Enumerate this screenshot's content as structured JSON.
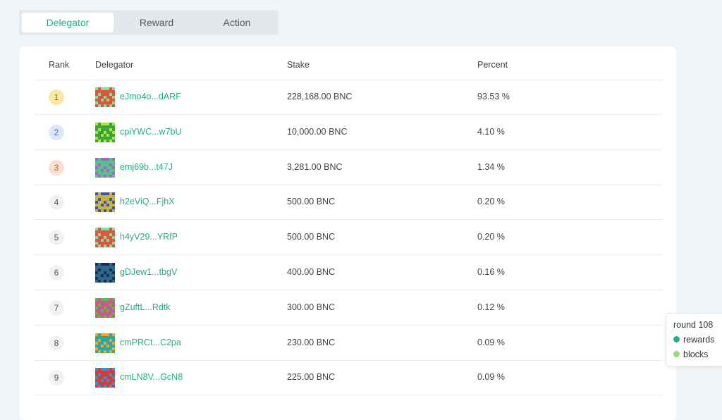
{
  "tabs": [
    {
      "label": "Delegator",
      "active": true
    },
    {
      "label": "Reward",
      "active": false
    },
    {
      "label": "Action",
      "active": false
    }
  ],
  "table": {
    "headers": {
      "rank": "Rank",
      "delegator": "Delegator",
      "stake": "Stake",
      "percent": "Percent"
    },
    "rows": [
      {
        "rank": "1",
        "address": "eJmo4o...dARF",
        "stake": "228,168.00 BNC",
        "percent": "93.53 %",
        "rank_bg": "#fde7a4",
        "rank_color": "#8a6a10",
        "avatar": {
          "bg": "#7ce0a0",
          "fg": "#e0553a"
        }
      },
      {
        "rank": "2",
        "address": "cpiYWC...w7bU",
        "stake": "10,000.00 BNC",
        "percent": "4.10 %",
        "rank_bg": "#dbe6fb",
        "rank_color": "#4a6aa8",
        "avatar": {
          "bg": "#b6e03b",
          "fg": "#3aa53a"
        }
      },
      {
        "rank": "3",
        "address": "emj69b...t47J",
        "stake": "3,281.00 BNC",
        "percent": "1.34 %",
        "rank_bg": "#fbe0d2",
        "rank_color": "#b0603a",
        "avatar": {
          "bg": "#9a6ac8",
          "fg": "#5cbf8a"
        }
      },
      {
        "rank": "4",
        "address": "h2eViQ...FjhX",
        "stake": "500.00 BNC",
        "percent": "0.20 %",
        "rank_bg": "#f0f2f5",
        "rank_color": "#555555",
        "avatar": {
          "bg": "#3b4fc8",
          "fg": "#c8b43a"
        }
      },
      {
        "rank": "5",
        "address": "h4yV29...YRfP",
        "stake": "500.00 BNC",
        "percent": "0.20 %",
        "rank_bg": "#f0f2f5",
        "rank_color": "#555555",
        "avatar": {
          "bg": "#7ce0a0",
          "fg": "#e0553a"
        }
      },
      {
        "rank": "6",
        "address": "gDJew1...tbgV",
        "stake": "400.00 BNC",
        "percent": "0.16 %",
        "rank_bg": "#f0f2f5",
        "rank_color": "#555555",
        "avatar": {
          "bg": "#1e2a5a",
          "fg": "#2a6a8a"
        }
      },
      {
        "rank": "7",
        "address": "gZuftL...Rdtk",
        "stake": "300.00 BNC",
        "percent": "0.12 %",
        "rank_bg": "#f0f2f5",
        "rank_color": "#555555",
        "avatar": {
          "bg": "#5cb84a",
          "fg": "#c85a8a"
        }
      },
      {
        "rank": "8",
        "address": "cmPRCt...C2pa",
        "stake": "230.00 BNC",
        "percent": "0.09 %",
        "rank_bg": "#f0f2f5",
        "rank_color": "#555555",
        "avatar": {
          "bg": "#f5a623",
          "fg": "#2aa8a8"
        }
      },
      {
        "rank": "9",
        "address": "cmLN8V...GcN8",
        "stake": "225.00 BNC",
        "percent": "0.09 %",
        "rank_bg": "#f0f2f5",
        "rank_color": "#555555",
        "avatar": {
          "bg": "#2a98d8",
          "fg": "#d83a3a"
        }
      }
    ]
  },
  "tooltip": {
    "title": "round 108",
    "items": [
      {
        "label": "rewards",
        "color": "#23b07d"
      },
      {
        "label": "blocks",
        "color": "#9ad879"
      }
    ]
  },
  "colors": {
    "accent": "#23b07d",
    "background": "#f2f5f8"
  }
}
